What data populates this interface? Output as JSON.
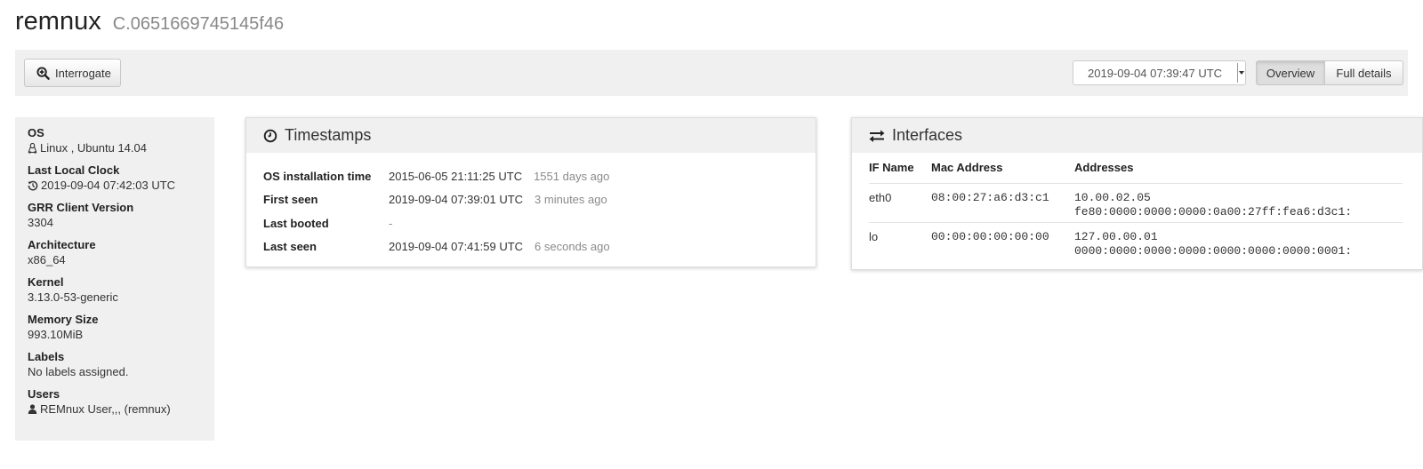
{
  "header": {
    "hostname": "remnux",
    "client_id": "C.0651669745145f46"
  },
  "toolbar": {
    "interrogate_label": "Interrogate",
    "selected_time": "2019-09-04 07:39:47 UTC",
    "view_overview_label": "Overview",
    "view_full_label": "Full details"
  },
  "sidebar": {
    "items": [
      {
        "label": "OS",
        "value": "Linux , Ubuntu 14.04",
        "icon": "linux-icon"
      },
      {
        "label": "Last Local Clock",
        "value": "2019-09-04 07:42:03 UTC",
        "icon": "history-icon"
      },
      {
        "label": "GRR Client Version",
        "value": "3304"
      },
      {
        "label": "Architecture",
        "value": "x86_64"
      },
      {
        "label": "Kernel",
        "value": "3.13.0-53-generic"
      },
      {
        "label": "Memory Size",
        "value": "993.10MiB"
      },
      {
        "label": "Labels",
        "value": "No labels assigned."
      },
      {
        "label": "Users",
        "value": "REMnux User,,, (remnux)",
        "icon": "user-icon"
      }
    ]
  },
  "timestamps": {
    "title": "Timestamps",
    "rows": [
      {
        "label": "OS installation time",
        "value": "2015-06-05 21:11:25 UTC",
        "relative": "1551 days ago"
      },
      {
        "label": "First seen",
        "value": "2019-09-04 07:39:01 UTC",
        "relative": "3 minutes ago"
      },
      {
        "label": "Last booted",
        "value": "-",
        "relative": ""
      },
      {
        "label": "Last seen",
        "value": "2019-09-04 07:41:59 UTC",
        "relative": "6 seconds ago"
      }
    ]
  },
  "interfaces": {
    "title": "Interfaces",
    "columns": [
      "IF Name",
      "Mac Address",
      "Addresses"
    ],
    "rows": [
      {
        "name": "eth0",
        "mac": "08:00:27:a6:d3:c1",
        "addresses": [
          "10.00.02.05",
          "fe80:0000:0000:0000:0a00:27ff:fea6:d3c1:"
        ]
      },
      {
        "name": "lo",
        "mac": "00:00:00:00:00:00",
        "addresses": [
          "127.00.00.01",
          "0000:0000:0000:0000:0000:0000:0000:0001:"
        ]
      }
    ]
  },
  "colors": {
    "panel_bg": "#f0f0f0",
    "muted_text": "#8a8a8a"
  }
}
